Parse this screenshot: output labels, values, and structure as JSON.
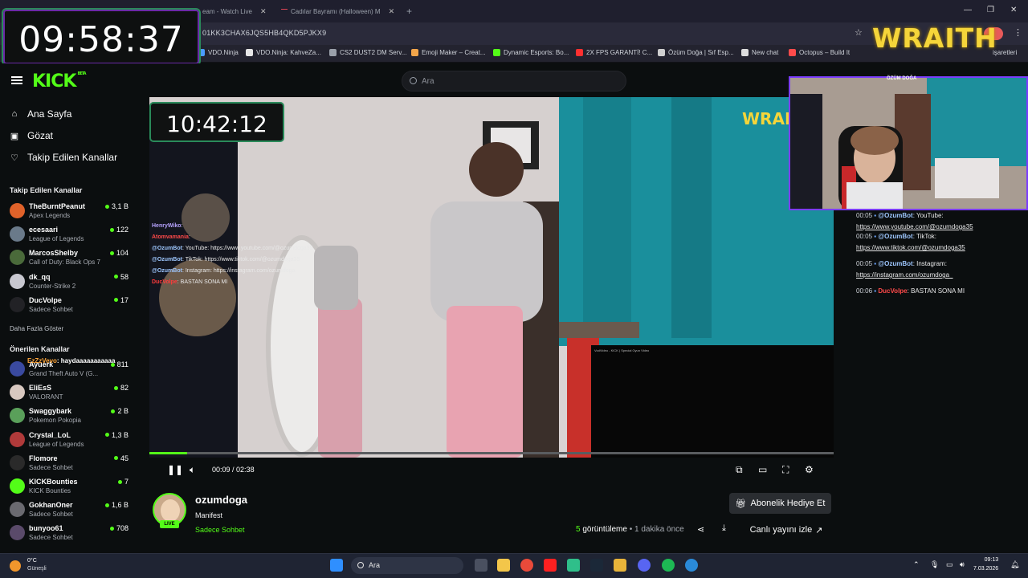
{
  "browser": {
    "tabs": [
      {
        "label": "eam - Watch Live"
      },
      {
        "label": "Cadılar Bayramı (Halloween) M"
      }
    ],
    "url": "01KK3CHAX6JQS5HB4QKD5PJKX9",
    "bookmarks": [
      {
        "label": "VDO.Ninja",
        "color": "#4a9cff"
      },
      {
        "label": "VDO.Ninja: KahveZa...",
        "color": "#e6e6e6"
      },
      {
        "label": "CS2 DUST2 DM Serv...",
        "color": "#9aa0aa"
      },
      {
        "label": "Emoji Maker – Creat...",
        "color": "#f2a54a"
      },
      {
        "label": "Dynamic Esports: Bo...",
        "color": "#53fc18"
      },
      {
        "label": "2X FPS GARANTİ! C...",
        "color": "#ff3030"
      },
      {
        "label": "Özüm Doğa | Sıf Esp...",
        "color": "#cfcfcf"
      },
      {
        "label": "New chat",
        "color": "#dddddd"
      },
      {
        "label": "Octopus – Build It",
        "color": "#ff4b4b"
      }
    ],
    "bookmarks_overflow": "işaretleri"
  },
  "overlay": {
    "timer": "09:58:37",
    "brand": "WRAITH"
  },
  "header": {
    "logo": "KICK",
    "logo_badge": "BETA",
    "search_placeholder": "Ara"
  },
  "sidebar": {
    "nav": [
      {
        "label": "Ana Sayfa",
        "icon": "home-icon"
      },
      {
        "label": "Gözat",
        "icon": "browse-icon"
      },
      {
        "label": "Takip Edilen Kanallar",
        "icon": "heart-icon"
      }
    ],
    "followed_title": "Takip Edilen Kanallar",
    "followed": [
      {
        "name": "TheBurntPeanut",
        "game": "Apex Legends",
        "viewers": "3,1 B",
        "color": "#e0622a"
      },
      {
        "name": "ecesaari",
        "game": "League of Legends",
        "viewers": "122",
        "color": "#6a7a8a"
      },
      {
        "name": "MarcosShelby",
        "game": "Call of Duty: Black Ops 7",
        "viewers": "104",
        "color": "#4a6a3a"
      },
      {
        "name": "dk_qq",
        "game": "Counter-Strike 2",
        "viewers": "58",
        "color": "#c8c8d0"
      },
      {
        "name": "DucVolpe",
        "game": "Sadece Sohbet",
        "viewers": "17",
        "color": "#222226"
      }
    ],
    "more": "Daha Fazla Göster",
    "recommended_title": "Önerilen Kanallar",
    "recommended": [
      {
        "name": "Ayuerk",
        "game": "Grand Theft Auto V (G...",
        "viewers": "811",
        "color": "#3a4aa0"
      },
      {
        "name": "EliEsS",
        "game": "VALORANT",
        "viewers": "82",
        "color": "#d8c8c0"
      },
      {
        "name": "Swaggybark",
        "game": "Pokemon Pokopia",
        "viewers": "2 B",
        "color": "#5aa05a"
      },
      {
        "name": "Crystal_LoL",
        "game": "League of Legends",
        "viewers": "1,3 B",
        "color": "#b03a3a"
      },
      {
        "name": "Flomore",
        "game": "Sadece Sohbet",
        "viewers": "45",
        "color": "#2a2a2a"
      },
      {
        "name": "KICKBounties",
        "game": "KICK Bounties",
        "viewers": "7",
        "color": "#53fc18"
      },
      {
        "name": "GokhanOner",
        "game": "Sadece Sohbet",
        "viewers": "1,6 B",
        "color": "#6a6a70"
      },
      {
        "name": "bunyoo61",
        "game": "Sadece Sohbet",
        "viewers": "708",
        "color": "#5a4a6a"
      }
    ],
    "chat_overlay_user": "EzZzVevo",
    "chat_overlay_text": ": haydaaaaaaaaaaa"
  },
  "video": {
    "timer": "10:42:12",
    "brand": "WRAI",
    "chat": [
      {
        "user": "HenryWiko",
        "text": ":"
      },
      {
        "user": "Atomvamania",
        "text": ":"
      },
      {
        "user": "@OzumBot",
        "text": ": YouTube: https://www.youtube.com/@ozumdoga35"
      },
      {
        "user": "@OzumBot",
        "text": ": TikTok: https://www.tiktok.com/@ozumdoga35"
      },
      {
        "user": "@OzumBot",
        "text": ": Instagram: https://instagram.com/ozumdoga"
      },
      {
        "user": "DucVolpe",
        "text": ": BASTAN SONA MI"
      }
    ],
    "subwin_title": "VodVideo - KICK | Special Oyun Video",
    "progress": 0.055,
    "current_time": "00:09",
    "duration": "02:38"
  },
  "channel": {
    "name": "ozumdoga",
    "title": "Manifest",
    "category": "Sadece Sohbet",
    "live_badge": "LIVE",
    "subscribe": "Abonelik Hediye Et",
    "views_count": "5",
    "views_label": "görüntüleme",
    "time_ago": "1 dakika önce",
    "watch_live": "Canlı yayını izle"
  },
  "cam": {
    "label": "ÖZÜM DOĞA"
  },
  "chat": {
    "messages": [
      {
        "time": "00:05",
        "user": "@OzumBot",
        "text": ": YouTube:",
        "link": "https://www.youtube.com/@ozumdoga35"
      },
      {
        "time": "00:05",
        "user": "@OzumBot",
        "text": ": TikTok:",
        "link": "https://www.tiktok.com/@ozumdoga35"
      },
      {
        "time": "00:05",
        "user": "@OzumBot",
        "text": ": Instagram:",
        "link": "https://instagram.com/ozumdoga_"
      },
      {
        "time": "00:06",
        "user": "DucVolpe",
        "text": ": BASTAN SONA MI",
        "link": ""
      }
    ]
  },
  "taskbar": {
    "weather_temp": "0°C",
    "weather_label": "Güneşli",
    "search": "Ara",
    "time": "09:13",
    "date": "7.03.2026"
  }
}
